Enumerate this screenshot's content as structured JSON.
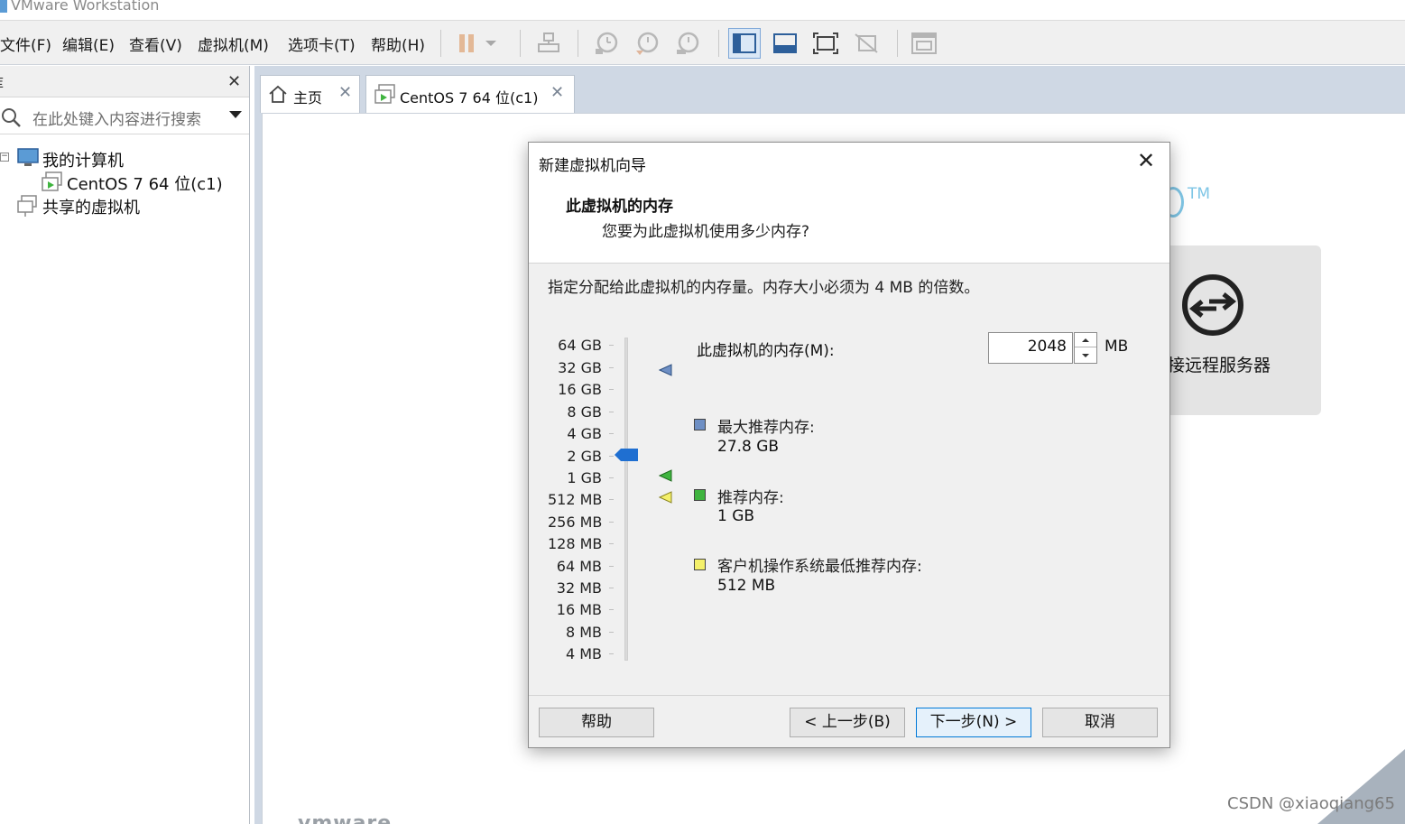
{
  "app": {
    "title": "VMware Workstation"
  },
  "menu": {
    "file": "文件(F)",
    "edit": "编辑(E)",
    "view": "查看(V)",
    "vm": "虚拟机(M)",
    "tabs": "选项卡(T)",
    "help": "帮助(H)"
  },
  "library": {
    "title": "库",
    "search_placeholder": "在此处键入内容进行搜索",
    "tree": {
      "my_computer": "我的计算机",
      "vm_item": "CentOS 7 64 位(c1)",
      "shared": "共享的虚拟机"
    }
  },
  "tabs": [
    {
      "label": "主页"
    },
    {
      "label": "CentOS 7 64 位(c1)"
    }
  ],
  "background": {
    "tm": "TM",
    "remote_card_label": "接远程服务器",
    "watermark": "CSDN @xiaoqiang65",
    "vmware_logo": "vmware"
  },
  "dialog": {
    "title": "新建虚拟机向导",
    "heading": "此虚拟机的内存",
    "subheading": "您要为此虚拟机使用多少内存?",
    "description": "指定分配给此虚拟机的内存量。内存大小必须为 4 MB 的倍数。",
    "scale_labels": [
      "64 GB",
      "32 GB",
      "16 GB",
      "8 GB",
      "4 GB",
      "2 GB",
      "1 GB",
      "512 MB",
      "256 MB",
      "128 MB",
      "64 MB",
      "32 MB",
      "16 MB",
      "8 MB",
      "4 MB"
    ],
    "memory_label": "此虚拟机的内存(M):",
    "memory_value": "2048",
    "memory_unit": "MB",
    "legend": {
      "max_label": "最大推荐内存:",
      "max_value": "27.8 GB",
      "rec_label": "推荐内存:",
      "rec_value": "1 GB",
      "min_label": "客户机操作系统最低推荐内存:",
      "min_value": "512 MB"
    },
    "colors": {
      "max": "#6e8fc4",
      "recommended": "#3fb43f",
      "minimum": "#f4f06a",
      "thumb": "#1f6fd1"
    },
    "buttons": {
      "help": "帮助",
      "back": "< 上一步(B)",
      "next": "下一步(N) >",
      "cancel": "取消"
    }
  }
}
